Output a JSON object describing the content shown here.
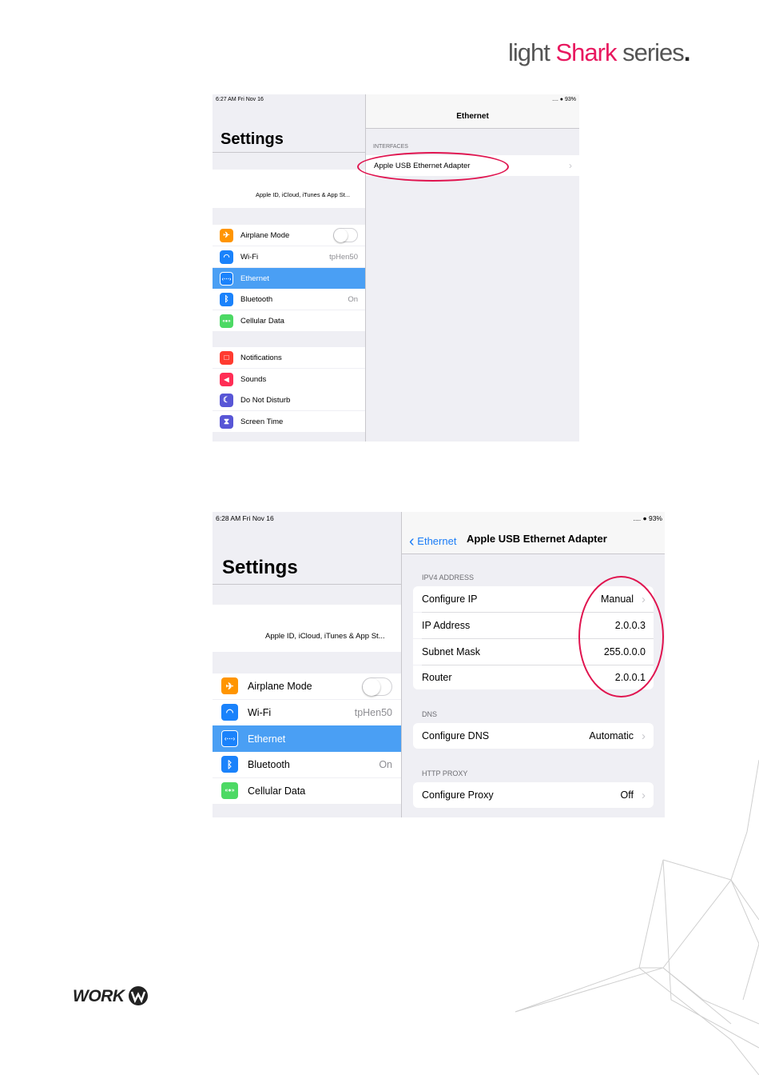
{
  "brand": {
    "light": "light",
    "shark": "Shark",
    "series": "series",
    "dot": ".",
    "accent": "#e8185f"
  },
  "shot1": {
    "status_time": "6:27 AM   Fri Nov 16",
    "status_right": ".... ● 93%",
    "left_title": "Settings",
    "apple_id": "Apple ID, iCloud, iTunes & App St...",
    "items": [
      {
        "label": "Airplane Mode",
        "value": "",
        "icon": "airplane-icon",
        "color": "#ff9500"
      },
      {
        "label": "Wi-Fi",
        "value": "tpHen50",
        "icon": "wifi-icon",
        "color": "#1a82fb"
      },
      {
        "label": "Ethernet",
        "value": "",
        "icon": "ethernet-icon",
        "color": "#1a82fb"
      },
      {
        "label": "Bluetooth",
        "value": "On",
        "icon": "bluetooth-icon",
        "color": "#1a82fb"
      },
      {
        "label": "Cellular Data",
        "value": "",
        "icon": "cellular-icon",
        "color": "#4cd964"
      }
    ],
    "items2": [
      {
        "label": "Notifications",
        "icon": "notifications-icon",
        "color": "#ff3b30"
      },
      {
        "label": "Sounds",
        "icon": "sounds-icon",
        "color": "#ff2d55"
      },
      {
        "label": "Do Not Disturb",
        "icon": "moon-icon",
        "color": "#5856d6"
      },
      {
        "label": "Screen Time",
        "icon": "hourglass-icon",
        "color": "#5856d6"
      }
    ],
    "right_title": "Ethernet",
    "section": "INTERFACES",
    "adapter": "Apple USB Ethernet Adapter"
  },
  "shot2": {
    "status_time": "6:28 AM   Fri Nov 16",
    "status_right": ".... ● 93%",
    "left_title": "Settings",
    "apple_id": "Apple ID, iCloud, iTunes & App St...",
    "items": [
      {
        "label": "Airplane Mode",
        "value": "",
        "icon": "airplane-icon",
        "color": "#ff9500"
      },
      {
        "label": "Wi-Fi",
        "value": "tpHen50",
        "icon": "wifi-icon",
        "color": "#1a82fb"
      },
      {
        "label": "Ethernet",
        "value": "",
        "icon": "ethernet-icon",
        "color": "#1a82fb"
      },
      {
        "label": "Bluetooth",
        "value": "On",
        "icon": "bluetooth-icon",
        "color": "#1a82fb"
      },
      {
        "label": "Cellular Data",
        "value": "",
        "icon": "cellular-icon",
        "color": "#4cd964"
      }
    ],
    "back_label": "Ethernet",
    "right_title": "Apple USB Ethernet Adapter",
    "ipv4_section": "IPV4 ADDRESS",
    "ipv4": [
      {
        "label": "Configure IP",
        "value": "Manual"
      },
      {
        "label": "IP Address",
        "value": "2.0.0.3"
      },
      {
        "label": "Subnet Mask",
        "value": "255.0.0.0"
      },
      {
        "label": "Router",
        "value": "2.0.0.1"
      }
    ],
    "dns_section": "DNS",
    "dns": {
      "label": "Configure DNS",
      "value": "Automatic"
    },
    "proxy_section": "HTTP PROXY",
    "proxy": {
      "label": "Configure Proxy",
      "value": "Off"
    }
  },
  "footer_logo": "WORK",
  "icons": {
    "airplane": "✈",
    "wifi": "◠",
    "ethernet": "‹⋯›",
    "bluetooth": "ᛒ",
    "cellular": "«●»",
    "notifications": "□",
    "sounds": "◀",
    "moon": "☾",
    "hourglass": "⧗",
    "chevron": "›",
    "back": "‹"
  }
}
